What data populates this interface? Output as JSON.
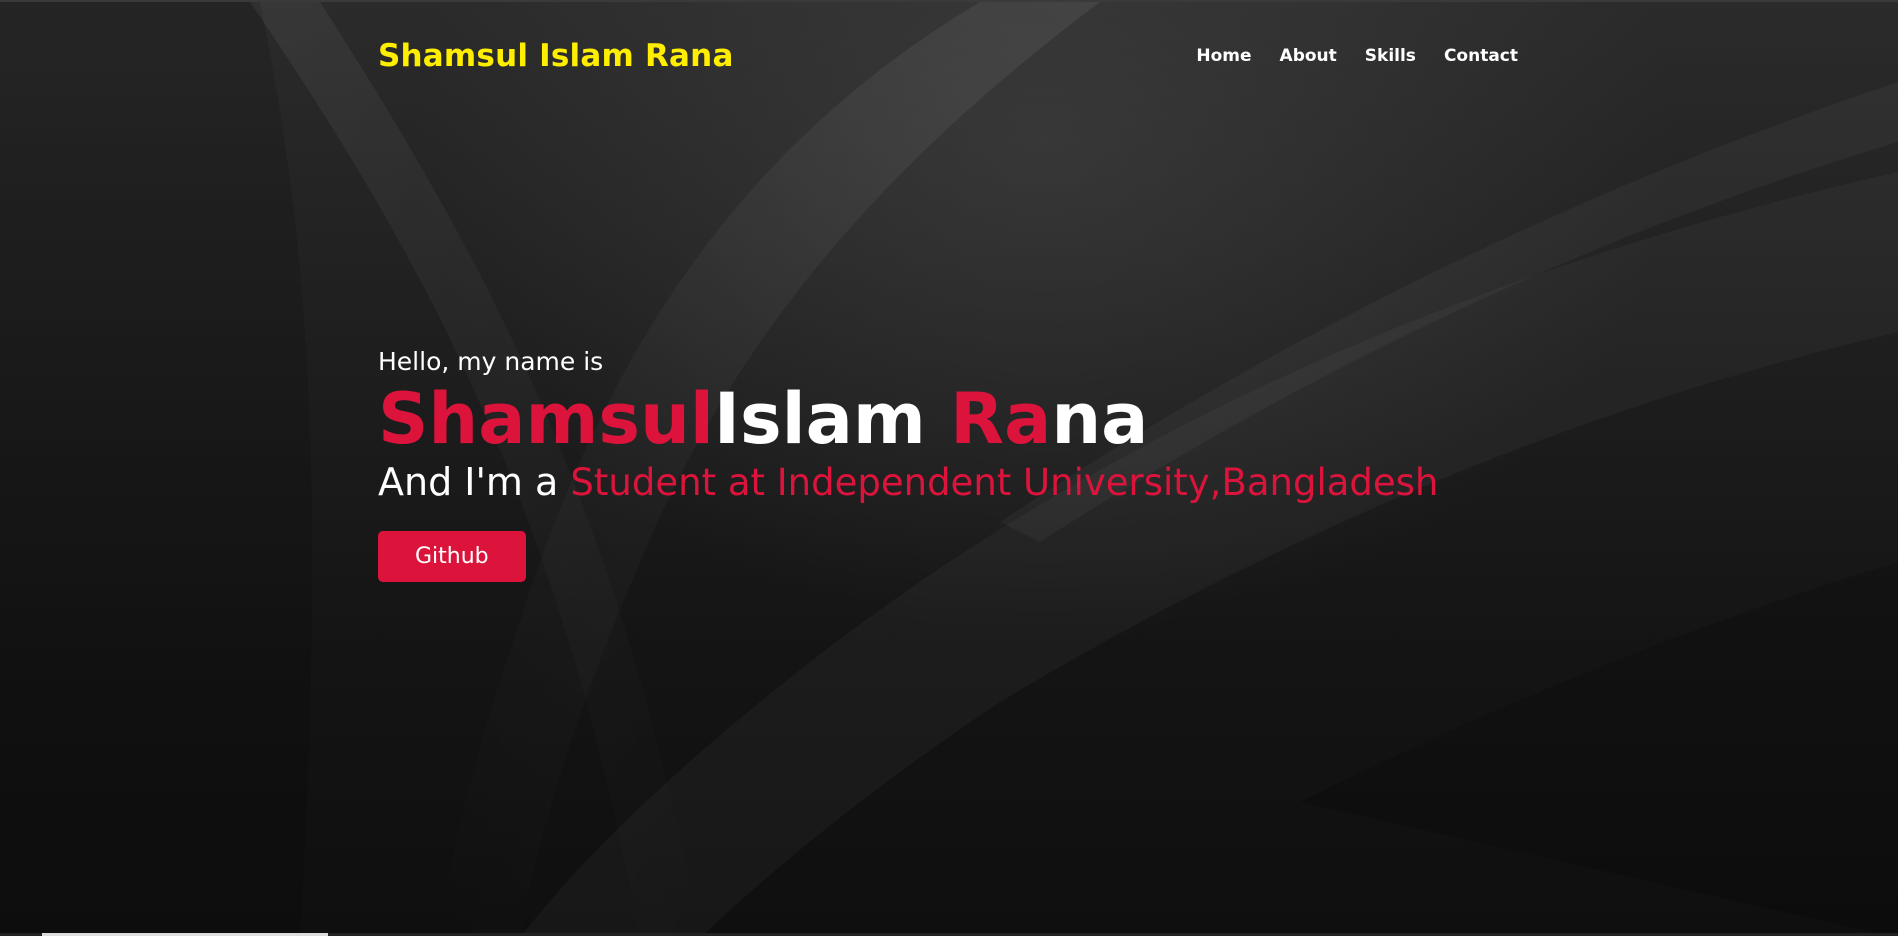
{
  "navbar": {
    "brand": "Shamsul Islam Rana",
    "menu": [
      {
        "label": "Home"
      },
      {
        "label": "About"
      },
      {
        "label": "Skills"
      },
      {
        "label": "Contact"
      }
    ]
  },
  "hero": {
    "greeting": "Hello, my name is",
    "name_parts": {
      "part1": "Shamsul",
      "part2": "Islam ",
      "part3": "Ra",
      "part4": "na"
    },
    "role_prefix": "And I'm a ",
    "role_highlight": "Student at Independent University,Bangladesh",
    "button_label": "Github"
  },
  "colors": {
    "brand": "#ffee00",
    "accent": "#dc143c",
    "text": "#ffffff",
    "background": "#1c1c1c"
  }
}
